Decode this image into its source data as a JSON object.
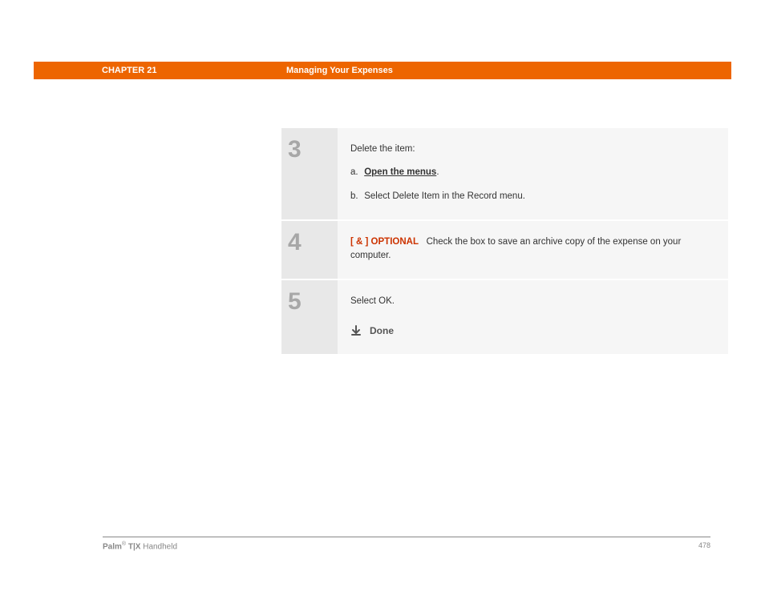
{
  "header": {
    "chapter_label": "CHAPTER 21",
    "chapter_title": "Managing Your Expenses"
  },
  "steps": {
    "s3": {
      "num": "3",
      "intro": "Delete the item:",
      "a_letter": "a.",
      "a_text": "Open the menus",
      "a_suffix": ".",
      "b_letter": "b.",
      "b_text": "Select Delete Item in the Record menu."
    },
    "s4": {
      "num": "4",
      "optional_tag": "[ & ]  OPTIONAL",
      "text": "Check the box to save an archive copy of the expense on your computer."
    },
    "s5": {
      "num": "5",
      "text": "Select OK.",
      "done": "Done"
    }
  },
  "footer": {
    "brand_bold": "Palm",
    "brand_reg": "®",
    "brand_model": " T|X",
    "brand_tail": " Handheld",
    "page": "478"
  }
}
